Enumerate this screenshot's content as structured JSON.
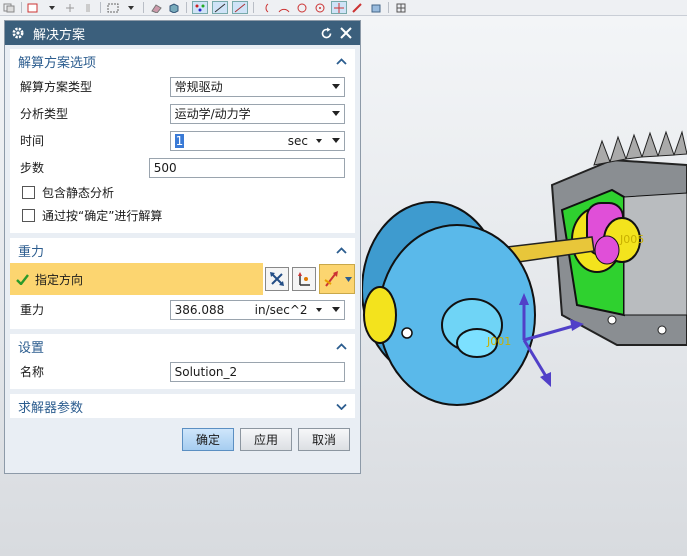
{
  "dialog": {
    "title": "解决方案",
    "sections": {
      "solution_options": {
        "title": "解算方案选项",
        "solution_type_label": "解算方案类型",
        "solution_type_value": "常规驱动",
        "analysis_type_label": "分析类型",
        "analysis_type_value": "运动学/动力学",
        "time_label": "时间",
        "time_value": "1",
        "time_unit": "sec",
        "steps_label": "步数",
        "steps_value": "500",
        "static_analysis_label": "包含静态分析",
        "solve_on_ok_label": "通过按“确定”进行解算"
      },
      "gravity": {
        "title": "重力",
        "specify_direction_label": "指定方向",
        "gravity_label": "重力",
        "gravity_value": "386.088",
        "gravity_unit": "in/sec^2"
      },
      "settings": {
        "title": "设置",
        "name_label": "名称",
        "name_value": "Solution_2"
      },
      "solver_params": {
        "title": "求解器参数"
      }
    },
    "buttons": {
      "ok": "确定",
      "apply": "应用",
      "cancel": "取消"
    }
  },
  "viewport": {
    "joint_label_1": "J001",
    "joint_label_2": "J005"
  },
  "colors": {
    "title_bar": "#3b5f7c",
    "section_title": "#2c5d8f",
    "highlight_row": "#fcd570",
    "model_blue": "#5ab9ea",
    "model_green": "#3ec93e",
    "model_magenta": "#e04fd8",
    "model_yellow": "#f3e31d"
  }
}
